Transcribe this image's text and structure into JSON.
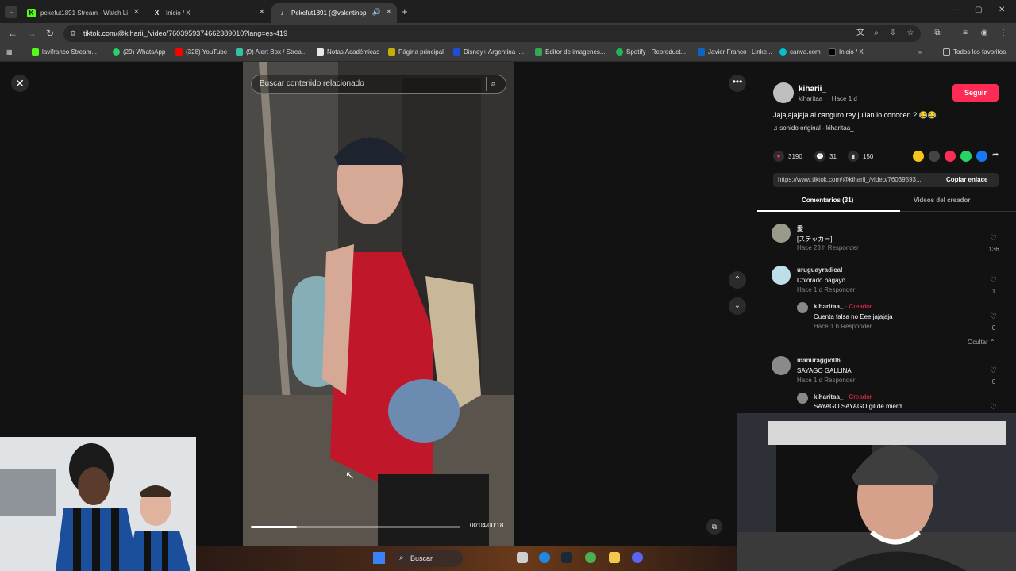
{
  "browser": {
    "tabs": [
      {
        "label": "pekefut1891 Stream - Watch Li",
        "active": false,
        "fav_color": "#53fc18",
        "fav_glyph": "K"
      },
      {
        "label": "Inicio / X",
        "active": false,
        "fav_color": "#000000",
        "fav_glyph": "X"
      },
      {
        "label": "Pekefut1891 (@valentinop",
        "active": true,
        "fav_color": "#000000",
        "fav_glyph": "♪"
      }
    ],
    "new_tab": "+",
    "url": "tiktok.com/@kiharii_/video/7603959374662389010?lang=es-419",
    "bookmarks": [
      {
        "label": "lavifranco Stream...",
        "color": "#53fc18"
      },
      {
        "label": "(29) WhatsApp",
        "color": "#25d366"
      },
      {
        "label": "(328) YouTube",
        "color": "#ff0000"
      },
      {
        "label": "(9) Alert Box / Strea...",
        "color": "#31c3a2"
      },
      {
        "label": "Notas Académicas",
        "color": "#e8e8e8"
      },
      {
        "label": "Página principal",
        "color": "#c8b000"
      },
      {
        "label": "Disney+ Argentina |...",
        "color": "#1d4ed8"
      },
      {
        "label": "Editor de imagenes...",
        "color": "#34a853"
      },
      {
        "label": "Spotify - Reproduct...",
        "color": "#1db954"
      },
      {
        "label": "Javier Franco | Linke...",
        "color": "#0a66c2"
      },
      {
        "label": "canva.com",
        "color": "#00c4cc"
      },
      {
        "label": "Inicio / X",
        "color": "#000000"
      }
    ],
    "all_bookmarks": "Todos los favoritos"
  },
  "video": {
    "search_placeholder": "Buscar contenido relacionado",
    "timecode": "00:04/00:18",
    "progress": 0.22
  },
  "panel": {
    "username": "kiharii_",
    "subline": "kiharitaa_ · Hace 1 d",
    "follow": "Seguir",
    "caption": "Jajajajajaja al canguro rey julian lo conocen ? 😂😂",
    "sound": "♫  sonido original - kiharitaa_",
    "likes": "3190",
    "comments_count": "31",
    "saves": "150",
    "link": "https://www.tiktok.com/@kiharii_/video/76039593...",
    "copy_link": "Copiar enlace",
    "tab_comments": "Comentarios (31)",
    "tab_creator": "Videos del creador",
    "hide": "Ocultar ⌃"
  },
  "comments": [
    {
      "name": "愛",
      "text": "[ステッカー]",
      "meta": "Hace 23 h      Responder",
      "likes": "136"
    },
    {
      "name": "uruguayradical",
      "text": "Colorado bagayo",
      "meta": "Hace 1 d      Responder",
      "likes": "1"
    },
    {
      "name": "kiharitaa_",
      "creator": " · Creador",
      "text": "Cuenta falsa no Eee jajajaja",
      "meta": "Hace 1 h      Responder",
      "likes": "0"
    },
    {
      "name": "manuraggio06",
      "text": "SAYAGO GALLINA",
      "meta": "Hace 1 d      Responder",
      "likes": "0"
    },
    {
      "name": "kiharitaa_",
      "creator": " · Creador",
      "text": "SAYAGO SAYAGO gil de mierd",
      "meta": "",
      "likes": ""
    }
  ],
  "taskbar": {
    "search": "Buscar"
  }
}
